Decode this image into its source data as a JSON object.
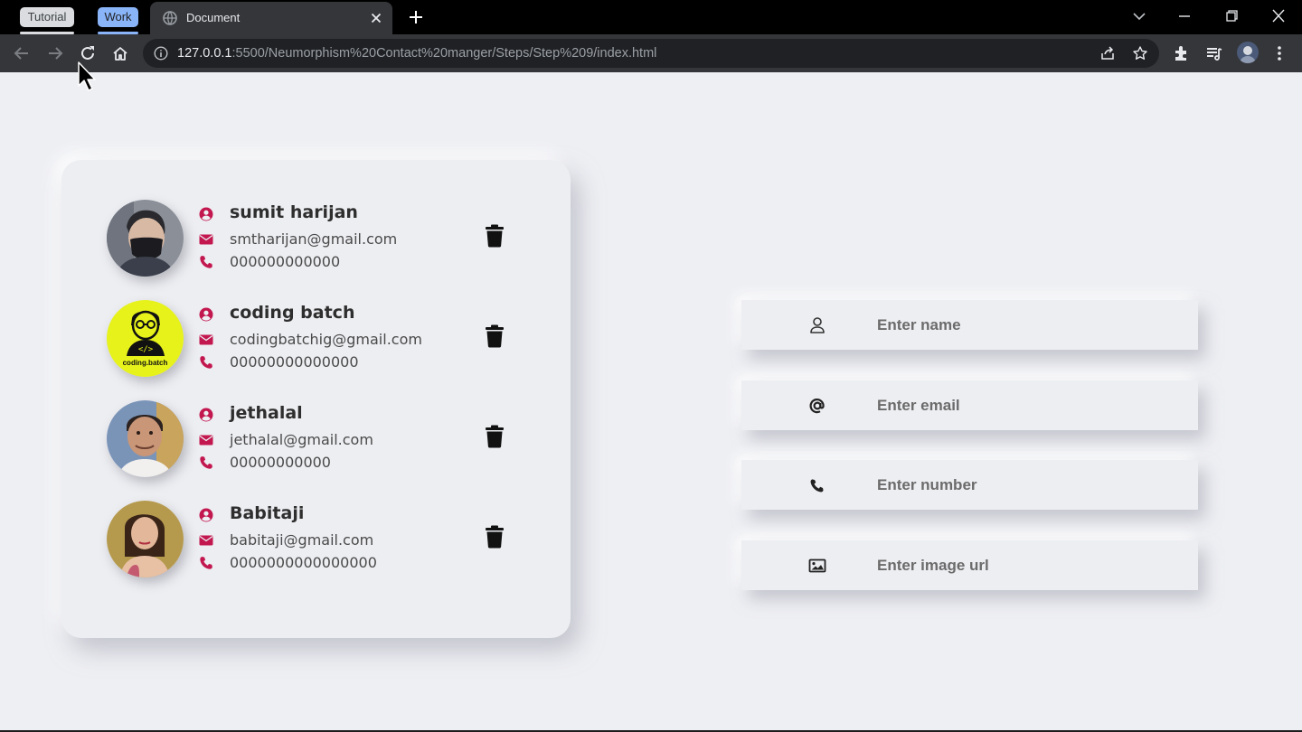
{
  "browser": {
    "tab_groups": [
      "Tutorial",
      "Work"
    ],
    "active_tab_title": "Document",
    "url_host": "127.0.0.1",
    "url_rest": ":5500/Neumorphism%20Contact%20manger/Steps/Step%209/index.html"
  },
  "contacts": [
    {
      "name": "sumit harijan",
      "email": "smtharijan@gmail.com",
      "phone": "000000000000"
    },
    {
      "name": "coding batch",
      "email": "codingbatchig@gmail.com",
      "phone": "00000000000000",
      "avatar_label": "coding.batch"
    },
    {
      "name": "jethalal",
      "email": "jethalal@gmail.com",
      "phone": "00000000000"
    },
    {
      "name": "Babitaji",
      "email": "babitaji@gmail.com",
      "phone": "0000000000000000"
    }
  ],
  "form": {
    "name_placeholder": "Enter name",
    "email_placeholder": "Enter email",
    "number_placeholder": "Enter number",
    "image_placeholder": "Enter image url"
  },
  "colors": {
    "accent": "#c2184f",
    "background": "#eeeff3",
    "trash": "#111111"
  },
  "icons": {
    "contact_row": [
      "user-circle-icon",
      "envelope-icon",
      "phone-icon"
    ],
    "delete": "trash-icon",
    "form": [
      "user-icon",
      "at-icon",
      "phone-icon",
      "image-icon"
    ]
  }
}
